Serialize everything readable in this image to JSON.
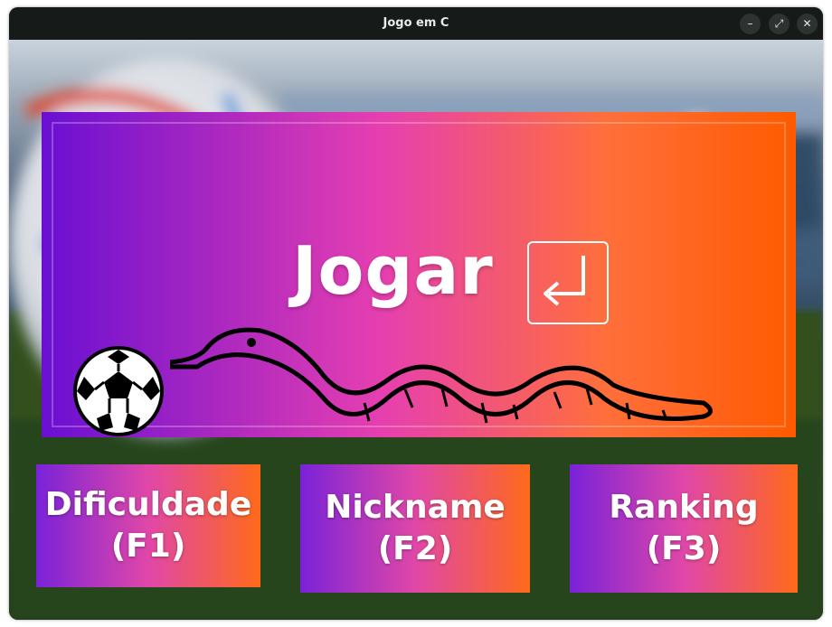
{
  "window": {
    "title": "Jogo em C",
    "controls": {
      "minimize": "–",
      "maximize": "⤢",
      "close": "✕"
    }
  },
  "play": {
    "label": "Jogar",
    "key_icon": "enter-key-icon"
  },
  "menu": [
    {
      "line1": "Dificuldade",
      "line2": "(F1)"
    },
    {
      "line1": "Nickname",
      "line2": "(F2)"
    },
    {
      "line1": "Ranking",
      "line2": "(F3)"
    }
  ],
  "colors": {
    "gradient_start": "#6a0fd2",
    "gradient_mid": "#e63fb0",
    "gradient_end": "#ff5a00",
    "text": "#ffffff"
  }
}
